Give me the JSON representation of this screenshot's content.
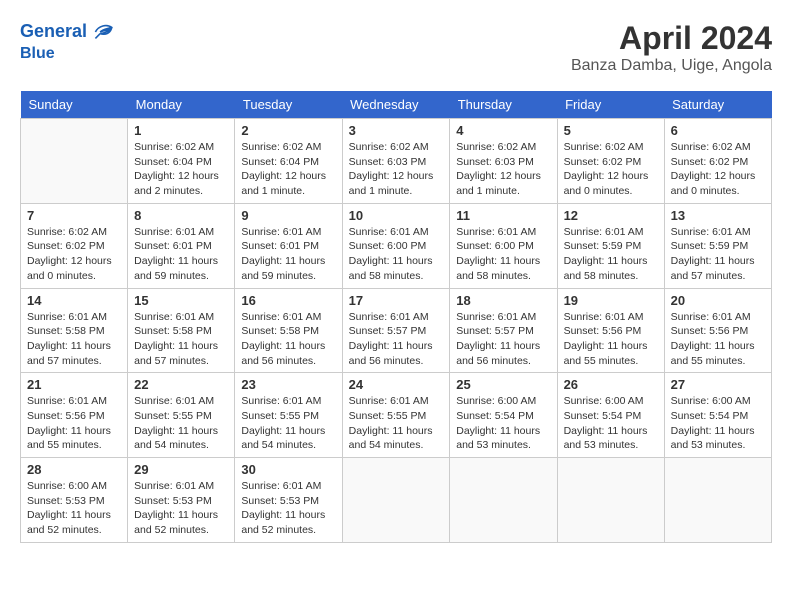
{
  "header": {
    "logo_line1": "General",
    "logo_line2": "Blue",
    "month_title": "April 2024",
    "location": "Banza Damba, Uige, Angola"
  },
  "weekdays": [
    "Sunday",
    "Monday",
    "Tuesday",
    "Wednesday",
    "Thursday",
    "Friday",
    "Saturday"
  ],
  "weeks": [
    [
      {
        "day": "",
        "info": ""
      },
      {
        "day": "1",
        "info": "Sunrise: 6:02 AM\nSunset: 6:04 PM\nDaylight: 12 hours\nand 2 minutes."
      },
      {
        "day": "2",
        "info": "Sunrise: 6:02 AM\nSunset: 6:04 PM\nDaylight: 12 hours\nand 1 minute."
      },
      {
        "day": "3",
        "info": "Sunrise: 6:02 AM\nSunset: 6:03 PM\nDaylight: 12 hours\nand 1 minute."
      },
      {
        "day": "4",
        "info": "Sunrise: 6:02 AM\nSunset: 6:03 PM\nDaylight: 12 hours\nand 1 minute."
      },
      {
        "day": "5",
        "info": "Sunrise: 6:02 AM\nSunset: 6:02 PM\nDaylight: 12 hours\nand 0 minutes."
      },
      {
        "day": "6",
        "info": "Sunrise: 6:02 AM\nSunset: 6:02 PM\nDaylight: 12 hours\nand 0 minutes."
      }
    ],
    [
      {
        "day": "7",
        "info": "Sunrise: 6:02 AM\nSunset: 6:02 PM\nDaylight: 12 hours\nand 0 minutes."
      },
      {
        "day": "8",
        "info": "Sunrise: 6:01 AM\nSunset: 6:01 PM\nDaylight: 11 hours\nand 59 minutes."
      },
      {
        "day": "9",
        "info": "Sunrise: 6:01 AM\nSunset: 6:01 PM\nDaylight: 11 hours\nand 59 minutes."
      },
      {
        "day": "10",
        "info": "Sunrise: 6:01 AM\nSunset: 6:00 PM\nDaylight: 11 hours\nand 58 minutes."
      },
      {
        "day": "11",
        "info": "Sunrise: 6:01 AM\nSunset: 6:00 PM\nDaylight: 11 hours\nand 58 minutes."
      },
      {
        "day": "12",
        "info": "Sunrise: 6:01 AM\nSunset: 5:59 PM\nDaylight: 11 hours\nand 58 minutes."
      },
      {
        "day": "13",
        "info": "Sunrise: 6:01 AM\nSunset: 5:59 PM\nDaylight: 11 hours\nand 57 minutes."
      }
    ],
    [
      {
        "day": "14",
        "info": "Sunrise: 6:01 AM\nSunset: 5:58 PM\nDaylight: 11 hours\nand 57 minutes."
      },
      {
        "day": "15",
        "info": "Sunrise: 6:01 AM\nSunset: 5:58 PM\nDaylight: 11 hours\nand 57 minutes."
      },
      {
        "day": "16",
        "info": "Sunrise: 6:01 AM\nSunset: 5:58 PM\nDaylight: 11 hours\nand 56 minutes."
      },
      {
        "day": "17",
        "info": "Sunrise: 6:01 AM\nSunset: 5:57 PM\nDaylight: 11 hours\nand 56 minutes."
      },
      {
        "day": "18",
        "info": "Sunrise: 6:01 AM\nSunset: 5:57 PM\nDaylight: 11 hours\nand 56 minutes."
      },
      {
        "day": "19",
        "info": "Sunrise: 6:01 AM\nSunset: 5:56 PM\nDaylight: 11 hours\nand 55 minutes."
      },
      {
        "day": "20",
        "info": "Sunrise: 6:01 AM\nSunset: 5:56 PM\nDaylight: 11 hours\nand 55 minutes."
      }
    ],
    [
      {
        "day": "21",
        "info": "Sunrise: 6:01 AM\nSunset: 5:56 PM\nDaylight: 11 hours\nand 55 minutes."
      },
      {
        "day": "22",
        "info": "Sunrise: 6:01 AM\nSunset: 5:55 PM\nDaylight: 11 hours\nand 54 minutes."
      },
      {
        "day": "23",
        "info": "Sunrise: 6:01 AM\nSunset: 5:55 PM\nDaylight: 11 hours\nand 54 minutes."
      },
      {
        "day": "24",
        "info": "Sunrise: 6:01 AM\nSunset: 5:55 PM\nDaylight: 11 hours\nand 54 minutes."
      },
      {
        "day": "25",
        "info": "Sunrise: 6:00 AM\nSunset: 5:54 PM\nDaylight: 11 hours\nand 53 minutes."
      },
      {
        "day": "26",
        "info": "Sunrise: 6:00 AM\nSunset: 5:54 PM\nDaylight: 11 hours\nand 53 minutes."
      },
      {
        "day": "27",
        "info": "Sunrise: 6:00 AM\nSunset: 5:54 PM\nDaylight: 11 hours\nand 53 minutes."
      }
    ],
    [
      {
        "day": "28",
        "info": "Sunrise: 6:00 AM\nSunset: 5:53 PM\nDaylight: 11 hours\nand 52 minutes."
      },
      {
        "day": "29",
        "info": "Sunrise: 6:01 AM\nSunset: 5:53 PM\nDaylight: 11 hours\nand 52 minutes."
      },
      {
        "day": "30",
        "info": "Sunrise: 6:01 AM\nSunset: 5:53 PM\nDaylight: 11 hours\nand 52 minutes."
      },
      {
        "day": "",
        "info": ""
      },
      {
        "day": "",
        "info": ""
      },
      {
        "day": "",
        "info": ""
      },
      {
        "day": "",
        "info": ""
      }
    ]
  ]
}
